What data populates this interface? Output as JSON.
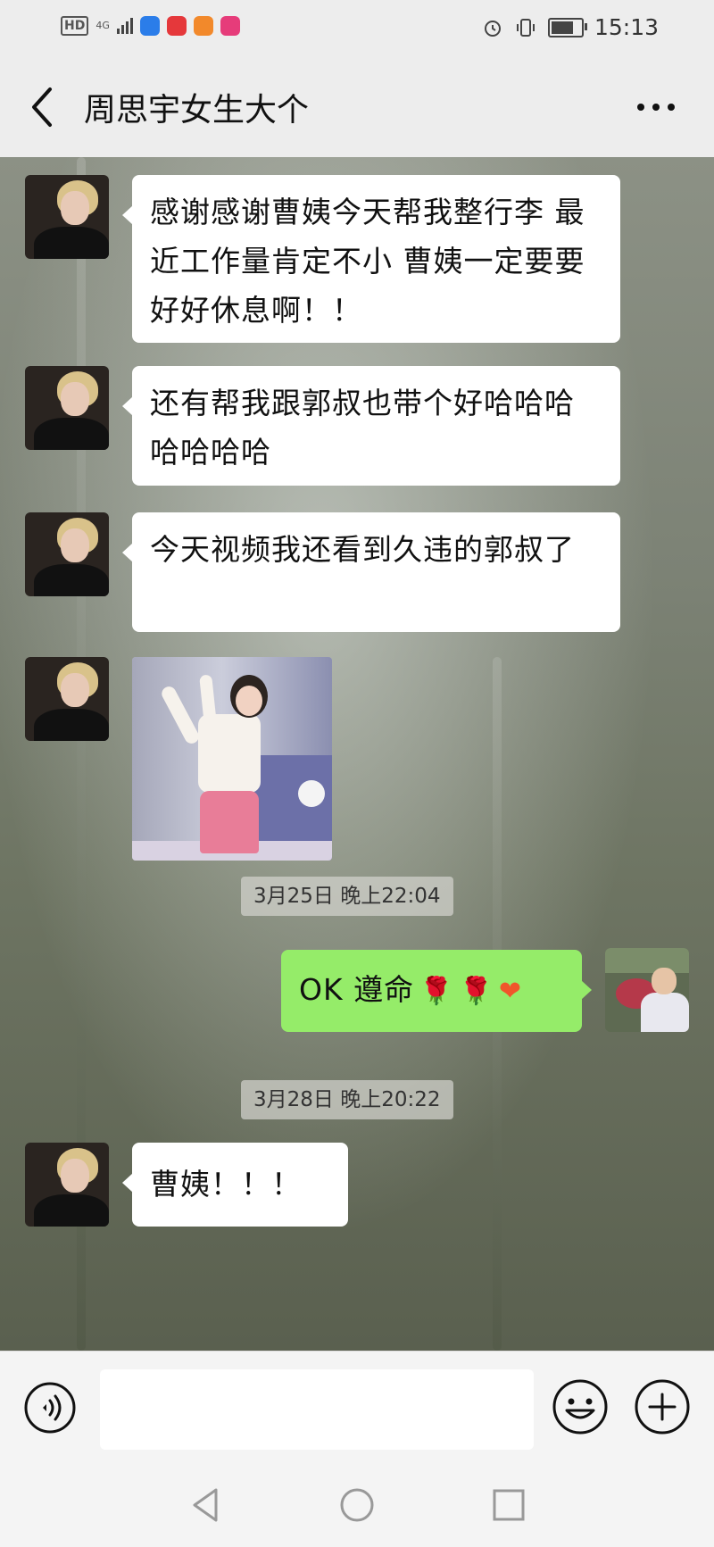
{
  "status_bar": {
    "hd": "HD",
    "network": "4G",
    "time": "15:13",
    "battery_level": 0.85
  },
  "header": {
    "title": "周思宇女生大个"
  },
  "messages": [
    {
      "type": "text",
      "from": "other",
      "text": "感谢感谢曹姨今天帮我整行李 最近工作量肯定不小 曹姨一定要要好好休息啊！！"
    },
    {
      "type": "text",
      "from": "other",
      "text": "还有帮我跟郭叔也带个好哈哈哈哈哈哈哈"
    },
    {
      "type": "text",
      "from": "other",
      "text": "今天视频我还看到久违的郭叔了"
    },
    {
      "type": "image",
      "from": "other"
    },
    {
      "type": "timestamp",
      "text": "3月25日 晚上22:04"
    },
    {
      "type": "text",
      "from": "me",
      "text": "OK 遵命",
      "emojis": [
        "🌹",
        "🌹",
        "❤"
      ]
    },
    {
      "type": "timestamp",
      "text": "3月28日 晚上20:22"
    },
    {
      "type": "text",
      "from": "other",
      "text": "曹姨！！！"
    }
  ],
  "colors": {
    "my_bubble": "#95ec69",
    "their_bubble": "#ffffff",
    "header_bg": "#ededed"
  },
  "input_bar": {
    "value": "",
    "voice_icon": "voice-icon",
    "emoji_icon": "emoji-icon",
    "plus_icon": "plus-icon"
  }
}
